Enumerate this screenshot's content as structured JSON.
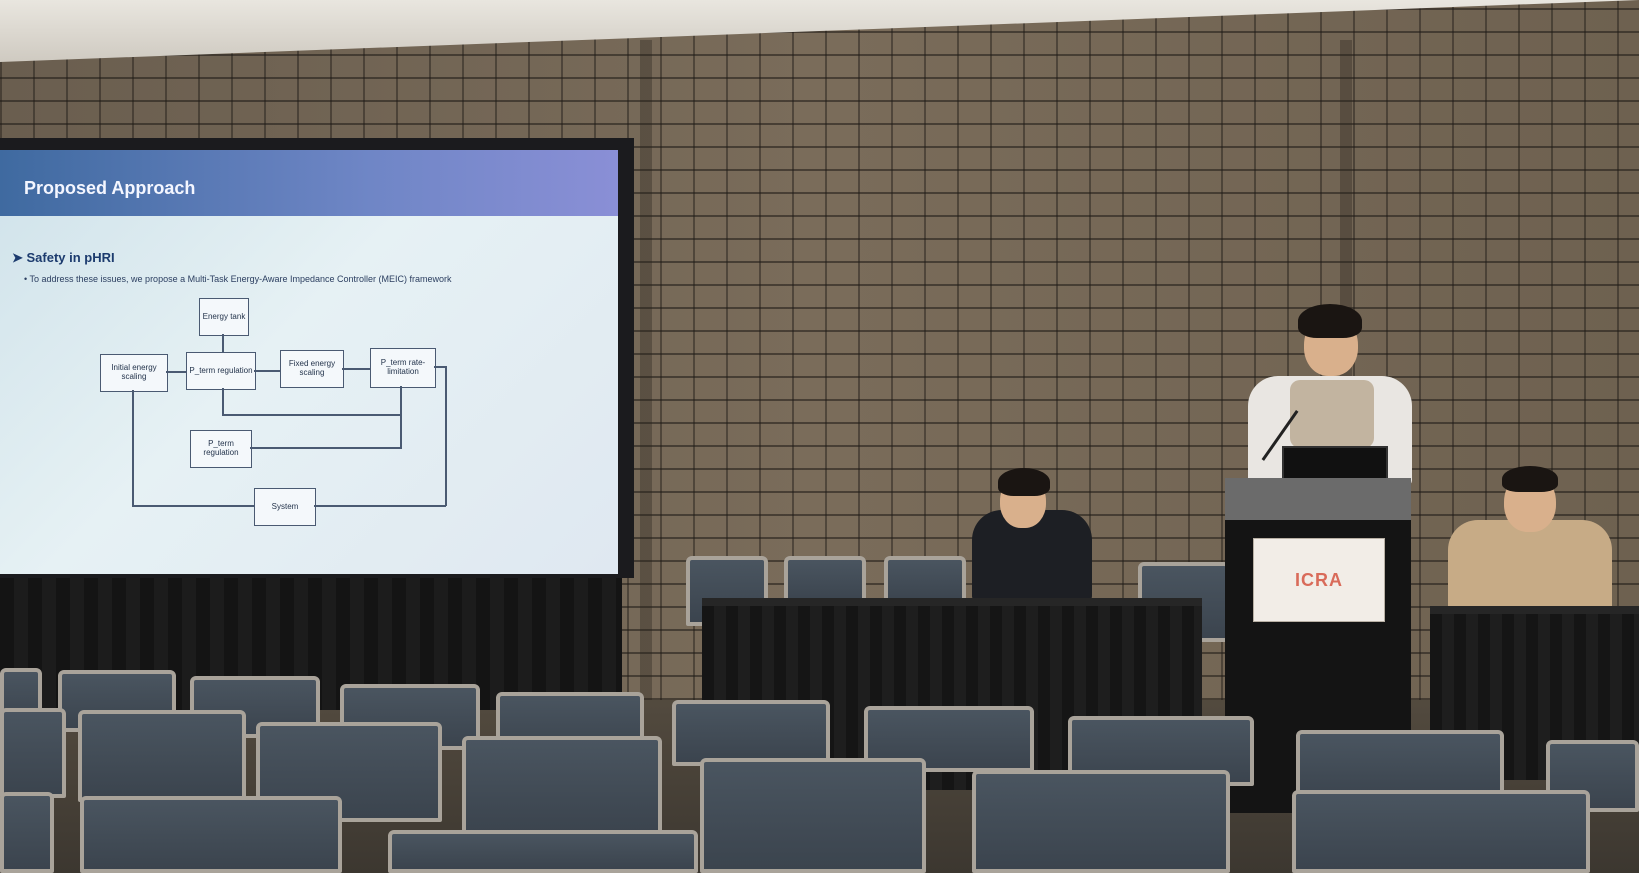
{
  "scene": {
    "description_colors": {
      "wall": "#6f6252",
      "curtain": "#181818",
      "slide_header": "#5f7ab8",
      "chair_fabric": "#44505a",
      "chair_frame": "#a9a39a",
      "sign_logo": "#d96b5a"
    }
  },
  "slide": {
    "title": "Proposed Approach",
    "subtitle": "Safety in pHRI",
    "bullet": "To address these issues, we propose a Multi-Task Energy-Aware Impedance Controller (MEIC) framework",
    "diagram": {
      "energy_tank": "Energy tank",
      "initial_energy": "Initial energy scaling",
      "p_term_regulation": "P_term regulation",
      "fixed_energy": "Fixed energy scaling",
      "p_term_rate": "P_term rate-limitation",
      "p_term_regulation_2": "P_term regulation",
      "system": "System"
    }
  },
  "podium": {
    "sign_text": "ICRA"
  }
}
